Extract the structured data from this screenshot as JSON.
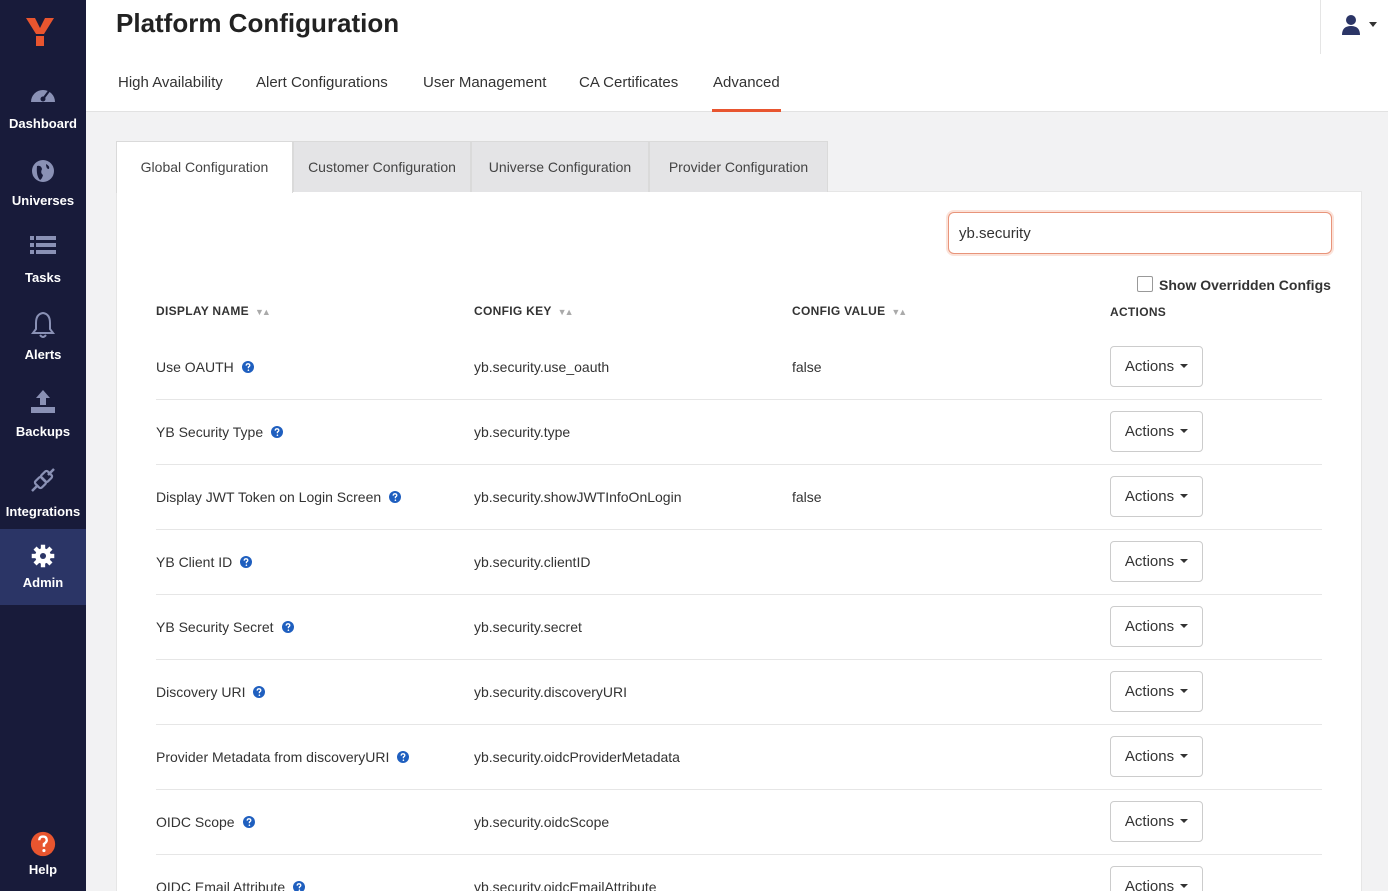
{
  "sidebar": {
    "logo": "yugabyte-logo",
    "items": [
      {
        "label": "Dashboard",
        "icon": "dashboard-gauge-icon"
      },
      {
        "label": "Universes",
        "icon": "globe-icon"
      },
      {
        "label": "Tasks",
        "icon": "list-icon"
      },
      {
        "label": "Alerts",
        "icon": "bell-icon"
      },
      {
        "label": "Backups",
        "icon": "upload-icon"
      },
      {
        "label": "Integrations",
        "icon": "plug-icon"
      },
      {
        "label": "Admin",
        "icon": "gear-icon",
        "active": true
      },
      {
        "label": "Help",
        "icon": "question-circle-icon"
      }
    ]
  },
  "header": {
    "title": "Platform Configuration",
    "user_icon": "user-icon"
  },
  "top_tabs": [
    {
      "label": "High Availability"
    },
    {
      "label": "Alert Configurations"
    },
    {
      "label": "User Management"
    },
    {
      "label": "CA Certificates"
    },
    {
      "label": "Advanced",
      "active": true
    }
  ],
  "sub_tabs": [
    {
      "label": "Global Configuration",
      "active": true
    },
    {
      "label": "Customer Configuration"
    },
    {
      "label": "Universe Configuration"
    },
    {
      "label": "Provider Configuration"
    }
  ],
  "search": {
    "value": "yb.security"
  },
  "show_overridden": {
    "label": "Show Overridden Configs",
    "checked": false
  },
  "table": {
    "headers": {
      "display_name": "DISPLAY NAME",
      "config_key": "CONFIG KEY",
      "config_value": "CONFIG VALUE",
      "actions": "ACTIONS"
    },
    "rows": [
      {
        "name": "Use OAUTH",
        "key": "yb.security.use_oauth",
        "value": "false",
        "action": "Actions"
      },
      {
        "name": "YB Security Type",
        "key": "yb.security.type",
        "value": "",
        "action": "Actions"
      },
      {
        "name": "Display JWT Token on Login Screen",
        "key": "yb.security.showJWTInfoOnLogin",
        "value": "false",
        "action": "Actions"
      },
      {
        "name": "YB Client ID",
        "key": "yb.security.clientID",
        "value": "",
        "action": "Actions"
      },
      {
        "name": "YB Security Secret",
        "key": "yb.security.secret",
        "value": "",
        "action": "Actions"
      },
      {
        "name": "Discovery URI",
        "key": "yb.security.discoveryURI",
        "value": "",
        "action": "Actions"
      },
      {
        "name": "Provider Metadata from discoveryURI",
        "key": "yb.security.oidcProviderMetadata",
        "value": "",
        "action": "Actions"
      },
      {
        "name": "OIDC Scope",
        "key": "yb.security.oidcScope",
        "value": "",
        "action": "Actions"
      },
      {
        "name": "OIDC Email Attribute",
        "key": "yb.security.oidcEmailAttribute",
        "value": "",
        "action": "Actions"
      }
    ]
  },
  "colors": {
    "sidebar_bg": "#181b3a",
    "sidebar_active": "#2b3566",
    "accent": "#e8552f",
    "help_icon": "#1f5fbf"
  }
}
